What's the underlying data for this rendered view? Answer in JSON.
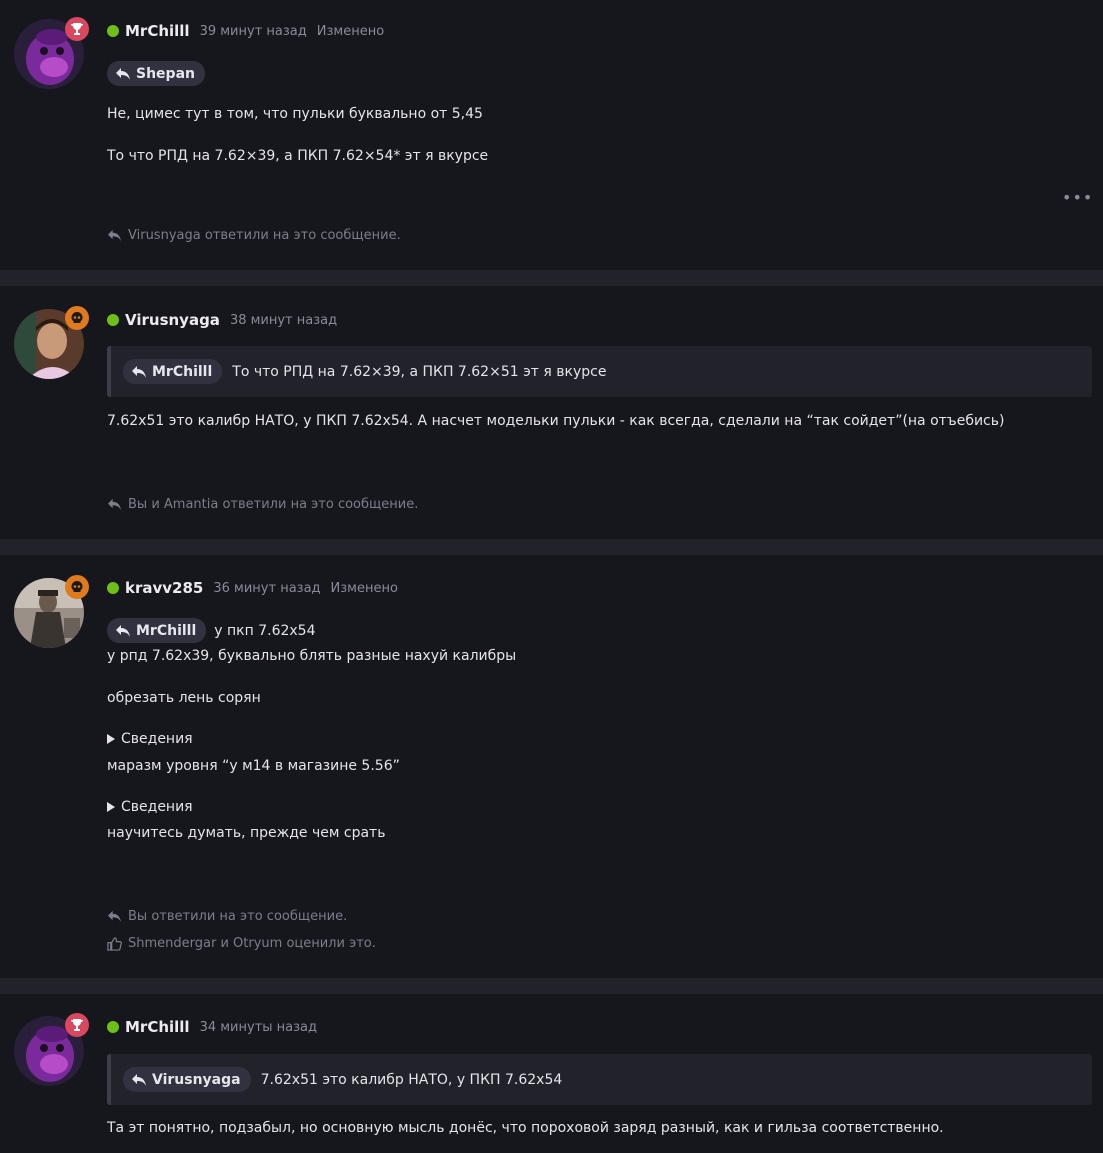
{
  "posts": [
    {
      "username": "MrChilll",
      "time": "39 минут назад",
      "edited": "Изменено",
      "reply_to": "Shepan",
      "paragraphs": [
        "Не, цимес тут в том, что пульки буквально от 5,45",
        "То что РПД на 7.62×39, а ПКП 7.62×54* эт я вкурсе"
      ],
      "more": "•••",
      "footer_replies": "Virusnyaga ответили на это сообщение."
    },
    {
      "username": "Virusnyaga",
      "time": "38 минут назад",
      "quote_user": "MrChilll",
      "quote_text": "То что РПД на 7.62×39, а ПКП 7.62×51 эт я вкурсе",
      "paragraphs": [
        "7.62x51 это калибр НАТО, у ПКП 7.62x54. А насчет модельки пульки - как всегда, сделали на “так сойдет”(на отъебись)"
      ],
      "footer_replies": "Вы и Amantia ответили на это сообщение."
    },
    {
      "username": "kravv285",
      "time": "36 минут назад",
      "edited": "Изменено",
      "reply_to": "MrChilll",
      "reply_inline": "у пкп 7.62x54",
      "paragraphs": [
        "у рпд 7.62x39, буквально блять разные нахуй калибры",
        "обрезать лень сорян",
        "маразм уровня “у м14 в магазине 5.56”",
        "научитесь думать, прежде чем срать"
      ],
      "details_label": "Сведения",
      "footer_replies": "Вы ответили на это сообщение.",
      "footer_likes": "Shmendergar и Otryum оценили это."
    },
    {
      "username": "MrChilll",
      "time": "34 минуты назад",
      "quote_user": "Virusnyaga",
      "quote_text": "7.62x51 это калибр НАТО, у ПКП 7.62x54",
      "paragraphs": [
        "Та эт понятно, подзабыл, но основную мысль донёс, что пороховой заряд разный, как и гильза соответственно."
      ]
    }
  ],
  "colors": {
    "background": "#16161d",
    "separator": "#22222b",
    "online": "#6fbf1a",
    "badge_red": "#d9485f",
    "badge_orange": "#e07a1e",
    "meta": "#8a8a9a"
  },
  "icons": [
    "reply-icon",
    "like-icon",
    "trophy-icon",
    "skull-icon",
    "details-triangle-icon"
  ]
}
